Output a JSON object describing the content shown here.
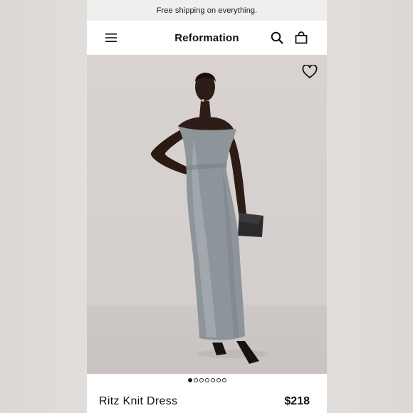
{
  "promo": {
    "text": "Free shipping on everything."
  },
  "header": {
    "brand": "Reformation",
    "menu_icon": "hamburger-menu-icon",
    "search_icon": "search-icon",
    "bag_icon": "shopping-bag-icon"
  },
  "hero": {
    "image": "model-in-grey-velvet-off-shoulder-maxi-dress",
    "wishlist_icon": "heart-outline-icon"
  },
  "carousel": {
    "total": 7,
    "active_index": 0
  },
  "product": {
    "name": "Ritz Knit Dress",
    "price": "$218"
  },
  "colors": {
    "accent": "#111111",
    "dress": "#8e959a",
    "background": "#d6d1cf"
  }
}
